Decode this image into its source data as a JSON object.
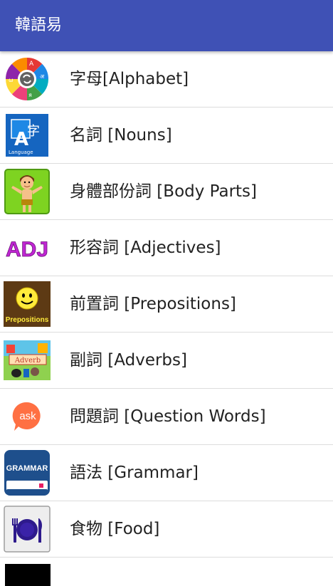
{
  "appbar": {
    "title": "韓語易",
    "color": "#3f51b5"
  },
  "menu": {
    "items": [
      {
        "label": "字母[Alphabet]",
        "icon": "alphabet-wheel-icon"
      },
      {
        "label": "名詞 [Nouns]",
        "icon": "language-translate-icon"
      },
      {
        "label": "身體部份詞 [Body Parts]",
        "icon": "body-boy-icon"
      },
      {
        "label": "形容詞 [Adjectives]",
        "icon": "adj-text-icon",
        "icon_text": "ADJ"
      },
      {
        "label": "前置詞 [Prepositions]",
        "icon": "smiley-prepositions-icon",
        "icon_text": "Prepositions"
      },
      {
        "label": "副詞 [Adverbs]",
        "icon": "adverb-picture-icon",
        "icon_text": "Adverb"
      },
      {
        "label": "問題詞 [Question Words]",
        "icon": "ask-bubble-icon",
        "icon_text": "ask"
      },
      {
        "label": "語法 [Grammar]",
        "icon": "grammar-book-icon",
        "icon_text": "GRAMMAR"
      },
      {
        "label": "食物 [Food]",
        "icon": "plate-cutlery-icon"
      }
    ]
  }
}
